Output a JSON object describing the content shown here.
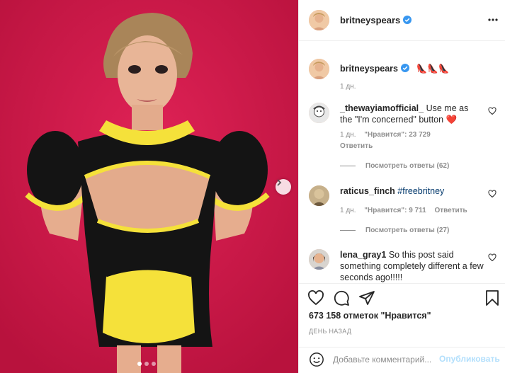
{
  "colors": {
    "media_background": "#d11b4a",
    "accent_link": "#00376b",
    "verified_blue": "#3897f0",
    "heart_red": "#ed4956",
    "publish_disabled": "#b2dffc",
    "outfit_black": "#141414",
    "outfit_yellow": "#f5e13a"
  },
  "header": {
    "username": "britneyspears",
    "verified_icon": "verified-badge-icon",
    "more_icon": "more-horizontal-icon"
  },
  "caption": {
    "username": "britneyspears",
    "text": "👠👠👠",
    "time": "1 дн."
  },
  "comments": [
    {
      "username": "_thewayiamofficial_",
      "text": "Use me as the \"I'm concerned\" button",
      "emoji": "❤️",
      "time": "1 дн.",
      "likes": "\"Нравится\": 23 729",
      "reply": "Ответить",
      "view_replies": "Посмотреть ответы (62)"
    },
    {
      "username": "raticus_finch",
      "hashtag": "#freebritney",
      "time": "1 дн.",
      "likes": "\"Нравится\": 9 711",
      "reply": "Ответить",
      "view_replies": "Посмотреть ответы (27)"
    },
    {
      "username": "lena_gray1",
      "text": "So this post said something completely different a few seconds ago!!!!!"
    }
  ],
  "actions": {
    "like_icon": "heart-outline-icon",
    "comment_icon": "comment-icon",
    "share_icon": "paper-plane-icon",
    "save_icon": "bookmark-icon"
  },
  "likes_count": "673 158 отметок \"Нравится\"",
  "post_date": "ДЕНЬ НАЗАД",
  "add_comment": {
    "emoji_icon": "smiley-icon",
    "placeholder": "Добавьте комментарий...",
    "publish": "Опубликовать"
  },
  "media": {
    "next_icon": "chevron-right-icon",
    "carousel_count": 3,
    "carousel_active": 1
  }
}
